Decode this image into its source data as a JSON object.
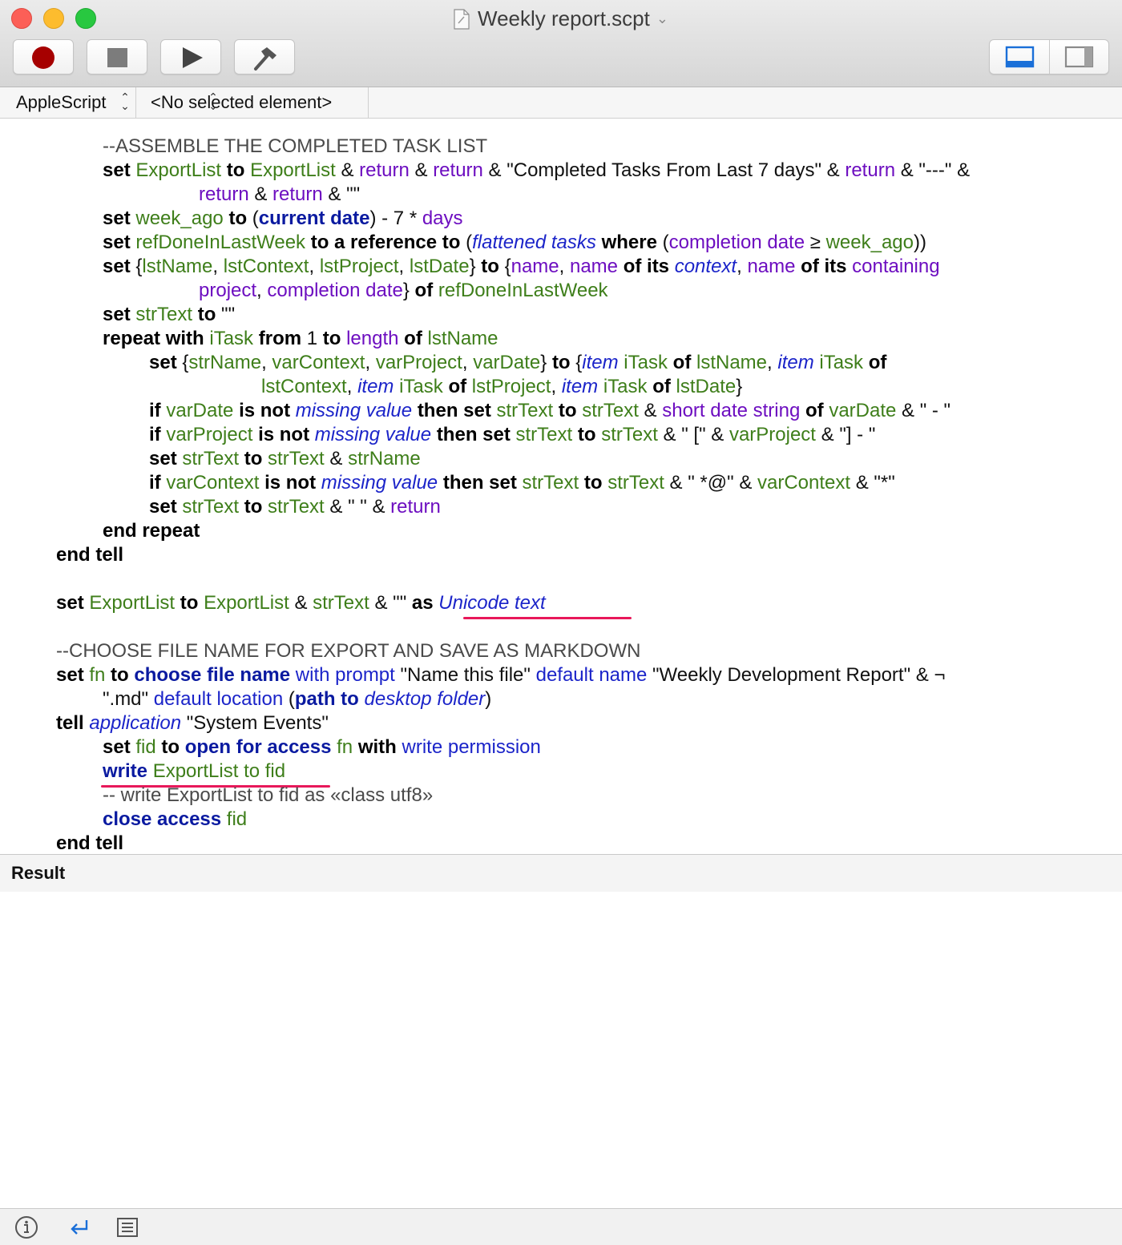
{
  "window": {
    "title": "Weekly report.scpt",
    "icons": {
      "close": "close-circle",
      "minimize": "minimize-circle",
      "zoom": "zoom-circle",
      "document": "script-document-icon",
      "title_menu": "chevron-down-icon"
    }
  },
  "toolbar": {
    "buttons": [
      {
        "name": "record",
        "icon": "record-icon",
        "color": "#a60000"
      },
      {
        "name": "stop",
        "icon": "stop-icon"
      },
      {
        "name": "run",
        "icon": "play-icon"
      },
      {
        "name": "compile",
        "icon": "hammer-icon"
      }
    ],
    "view_toggle": [
      "show-result-pane-icon",
      "show-sidebar-icon"
    ],
    "accent": "#1a6fd8"
  },
  "navbar": {
    "language": "AppleScript",
    "element": "<No selected element>"
  },
  "colors": {
    "keyword": "#000000",
    "command": "#0a1aa0",
    "variable": "#3e7e1a",
    "property": "#6d0ec0",
    "class": "#1b24c9",
    "underline": "#e8185a"
  },
  "code": {
    "l1": [
      "--ASSEMBLE THE COMPLETED TASK LIST"
    ],
    "l2": [
      "set",
      " ",
      "ExportList",
      " ",
      "to",
      " ",
      "ExportList",
      " & ",
      "return",
      " & ",
      "return",
      " & \"Completed Tasks From Last 7 days\" & ",
      "return",
      " & \"---\" &"
    ],
    "l3": [
      "return",
      " & ",
      "return",
      " & \"\""
    ],
    "l4": [
      "set",
      " ",
      "week_ago",
      " ",
      "to",
      " (",
      "current date",
      ") - 7 * ",
      "days"
    ],
    "l5": [
      "set",
      " ",
      "refDoneInLastWeek",
      " ",
      "to a reference to",
      " (",
      "flattened tasks",
      " ",
      "where",
      " (",
      "completion date",
      " ≥ ",
      "week_ago",
      "))"
    ],
    "l6": [
      "set",
      " {",
      "lstName",
      ", ",
      "lstContext",
      ", ",
      "lstProject",
      ", ",
      "lstDate",
      "} ",
      "to",
      " {",
      "name",
      ", ",
      "name",
      " ",
      "of its",
      " ",
      "context",
      ", ",
      "name",
      " ",
      "of its",
      " ",
      "containing"
    ],
    "l7": [
      "project",
      ", ",
      "completion date",
      "} ",
      "of",
      " ",
      "refDoneInLastWeek"
    ],
    "l8": [
      "set",
      " ",
      "strText",
      " ",
      "to",
      " \"\""
    ],
    "l9": [
      "repeat with",
      " ",
      "iTask",
      " ",
      "from",
      " 1 ",
      "to",
      " ",
      "length",
      " ",
      "of",
      " ",
      "lstName"
    ],
    "l10": [
      "set",
      " {",
      "strName",
      ", ",
      "varContext",
      ", ",
      "varProject",
      ", ",
      "varDate",
      "} ",
      "to",
      " {",
      "item",
      " ",
      "iTask",
      " ",
      "of",
      " ",
      "lstName",
      ", ",
      "item",
      " ",
      "iTask",
      " ",
      "of"
    ],
    "l11": [
      "lstContext",
      ", ",
      "item",
      " ",
      "iTask",
      " ",
      "of",
      " ",
      "lstProject",
      ", ",
      "item",
      " ",
      "iTask",
      " ",
      "of",
      " ",
      "lstDate",
      "}"
    ],
    "l12": [
      "if",
      " ",
      "varDate",
      " ",
      "is not",
      " ",
      "missing value",
      " ",
      "then set",
      " ",
      "strText",
      " ",
      "to",
      " ",
      "strText",
      " & ",
      "short date string",
      " ",
      "of",
      " ",
      "varDate",
      " & \" - \""
    ],
    "l13": [
      "if",
      " ",
      "varProject",
      " ",
      "is not",
      " ",
      "missing value",
      " ",
      "then set",
      " ",
      "strText",
      " ",
      "to",
      " ",
      "strText",
      " & \" [\" & ",
      "varProject",
      " & \"] - \""
    ],
    "l14": [
      "set",
      " ",
      "strText",
      " ",
      "to",
      " ",
      "strText",
      " & ",
      "strName"
    ],
    "l15": [
      "if",
      " ",
      "varContext",
      " ",
      "is not",
      " ",
      "missing value",
      " ",
      "then set",
      " ",
      "strText",
      " ",
      "to",
      " ",
      "strText",
      " & \" *@\" & ",
      "varContext",
      " & \"*\""
    ],
    "l16": [
      "set",
      " ",
      "strText",
      " ",
      "to",
      " ",
      "strText",
      " & \" \" & ",
      "return"
    ],
    "l17": [
      "end repeat"
    ],
    "l18": [
      "end tell"
    ],
    "l19": [
      "set",
      " ",
      "ExportList",
      " ",
      "to",
      " ",
      "ExportList",
      " & ",
      "strText",
      " & \"\" ",
      "as",
      " ",
      "Unicode text"
    ],
    "l20": [
      "--CHOOSE FILE NAME FOR EXPORT AND SAVE AS MARKDOWN"
    ],
    "l21": [
      "set",
      " ",
      "fn",
      " ",
      "to",
      " ",
      "choose file name",
      " ",
      "with prompt",
      " \"Name this file\" ",
      "default name",
      " \"Weekly Development Report\" & ¬"
    ],
    "l22": [
      "\".md\" ",
      "default location",
      " (",
      "path to",
      " ",
      "desktop folder",
      ")"
    ],
    "l23": [
      "tell",
      " ",
      "application",
      " \"System Events\""
    ],
    "l24": [
      "set",
      " ",
      "fid",
      " ",
      "to",
      " ",
      "open for access",
      " ",
      "fn",
      " ",
      "with",
      " ",
      "write permission"
    ],
    "l25": [
      "write",
      " ",
      "ExportList",
      " ",
      "to",
      " ",
      "fid"
    ],
    "l26": [
      "-- write ExportList to fid as «class utf8»"
    ],
    "l27": [
      "close access",
      " ",
      "fid"
    ],
    "l28": [
      "end tell"
    ]
  },
  "result": {
    "label": "Result"
  },
  "bottombar": {
    "icons": [
      "info-icon",
      "return-arrow-icon",
      "log-list-icon"
    ]
  }
}
